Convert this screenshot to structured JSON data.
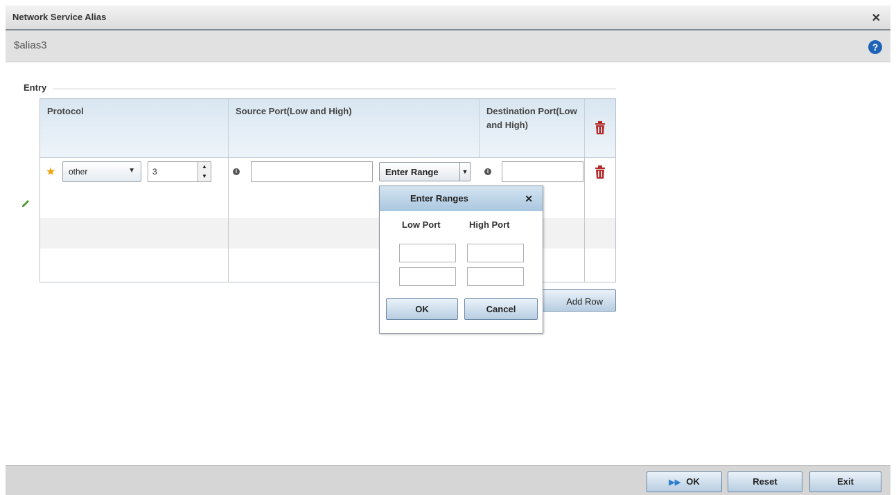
{
  "window": {
    "title": "Network Service Alias",
    "alias": "$alias3"
  },
  "entry": {
    "section_label": "Entry",
    "columns": [
      "Protocol",
      "Source Port(Low and High)",
      "Destination Port(Low and High)"
    ],
    "row": {
      "protocol_value": "other",
      "protocol_number": "3",
      "source_port_value": "",
      "range_button_label": "Enter Range",
      "destination_port_value": ""
    },
    "add_row_label": "Add Row"
  },
  "popup": {
    "title": "Enter Ranges",
    "low_port_label": "Low Port",
    "high_port_label": "High Port",
    "ok_label": "OK",
    "cancel_label": "Cancel"
  },
  "footer": {
    "ok_label": "OK",
    "reset_label": "Reset",
    "exit_label": "Exit"
  },
  "colors": {
    "accent": "#1f63b8",
    "star": "#f1a10c",
    "trash": "#b22a2a"
  }
}
